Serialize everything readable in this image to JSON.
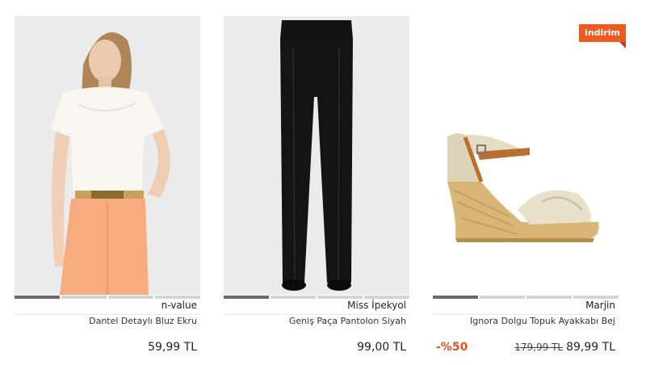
{
  "products": [
    {
      "brand": "n-value",
      "name": "Dantel Detaylı Bluz Ekru",
      "price": "59,99 TL",
      "image_alt": "blouse-photo",
      "image_tabs": 4
    },
    {
      "brand": "Miss İpekyol",
      "name": "Geniş Paça Pantolon Siyah",
      "price": "99,00 TL",
      "image_alt": "trousers-photo",
      "image_tabs": 4
    },
    {
      "brand": "Marjin",
      "name": "Ignora Dolgu Topuk Ayakkabı Bej",
      "old_price": "179,99 TL",
      "price": "89,99 TL",
      "discount": "-%50",
      "badge": "indirim",
      "image_alt": "wedge-sandal-photo",
      "image_tabs": 4
    }
  ],
  "colors": {
    "accent": "#ec5a22",
    "discount_text": "#e2511f",
    "tab_active": "#6b6b6b",
    "tab_inactive": "#d4d4d4"
  }
}
